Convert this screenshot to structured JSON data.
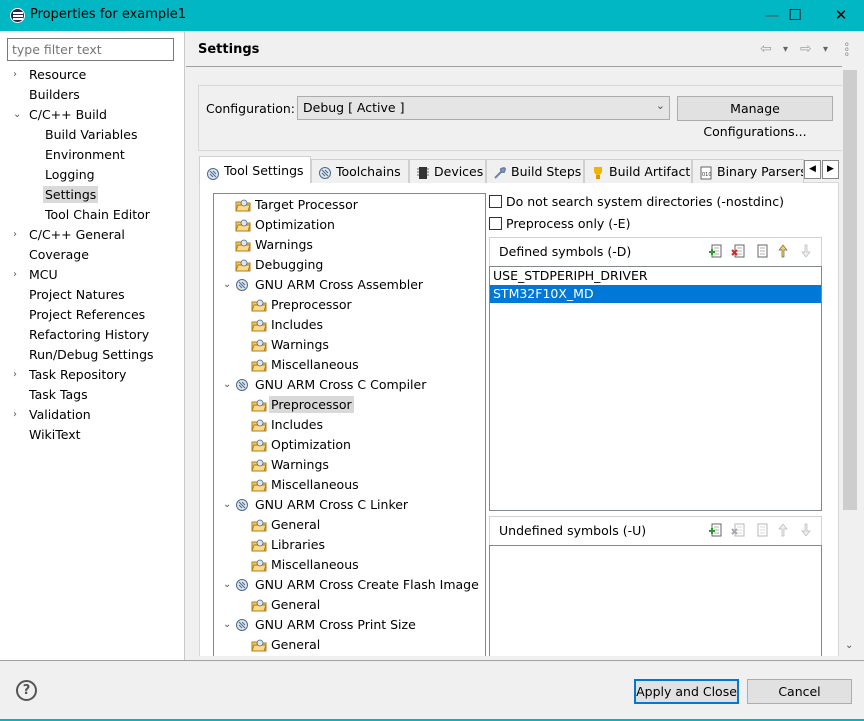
{
  "window": {
    "title": "Properties for example1",
    "minimize": "—",
    "maximize": "☐",
    "close": "✕",
    "accent": "#00b7c3"
  },
  "filter": {
    "placeholder": "type filter text"
  },
  "nav": [
    {
      "label": "Resource",
      "level": 0,
      "arrow": "›"
    },
    {
      "label": "Builders",
      "level": 0
    },
    {
      "label": "C/C++ Build",
      "level": 0,
      "arrow": "⌄"
    },
    {
      "label": "Build Variables",
      "level": 1
    },
    {
      "label": "Environment",
      "level": 1
    },
    {
      "label": "Logging",
      "level": 1
    },
    {
      "label": "Settings",
      "level": 1,
      "selected": true
    },
    {
      "label": "Tool Chain Editor",
      "level": 1
    },
    {
      "label": "C/C++ General",
      "level": 0,
      "arrow": "›"
    },
    {
      "label": "Coverage",
      "level": 0
    },
    {
      "label": "MCU",
      "level": 0,
      "arrow": "›"
    },
    {
      "label": "Project Natures",
      "level": 0
    },
    {
      "label": "Project References",
      "level": 0
    },
    {
      "label": "Refactoring History",
      "level": 0
    },
    {
      "label": "Run/Debug Settings",
      "level": 0
    },
    {
      "label": "Task Repository",
      "level": 0,
      "arrow": "›"
    },
    {
      "label": "Task Tags",
      "level": 0
    },
    {
      "label": "Validation",
      "level": 0,
      "arrow": "›"
    },
    {
      "label": "WikiText",
      "level": 0
    }
  ],
  "header": {
    "title": "Settings",
    "back_icon": "⇦",
    "forward_icon": "⇨",
    "menu_icon": "▾"
  },
  "configuration": {
    "label": "Configuration:",
    "value": "Debug  [ Active ]",
    "manage_label": "Manage Configurations..."
  },
  "tabs": [
    {
      "label": "Tool Settings",
      "icon": "gear-icon",
      "active": true
    },
    {
      "label": "Toolchains",
      "icon": "gear-icon"
    },
    {
      "label": "Devices",
      "icon": "chip-icon"
    },
    {
      "label": "Build Steps",
      "icon": "wrench-icon"
    },
    {
      "label": "Build Artifact",
      "icon": "trophy-icon"
    },
    {
      "label": "Binary Parsers",
      "icon": "binary-file-icon"
    }
  ],
  "tool_tree": [
    {
      "label": "Target Processor",
      "level": 0
    },
    {
      "label": "Optimization",
      "level": 0
    },
    {
      "label": "Warnings",
      "level": 0
    },
    {
      "label": "Debugging",
      "level": 0
    },
    {
      "label": "GNU ARM Cross Assembler",
      "level": 0,
      "tool": true
    },
    {
      "label": "Preprocessor",
      "level": 1
    },
    {
      "label": "Includes",
      "level": 1
    },
    {
      "label": "Warnings",
      "level": 1
    },
    {
      "label": "Miscellaneous",
      "level": 1
    },
    {
      "label": "GNU ARM Cross C Compiler",
      "level": 0,
      "tool": true
    },
    {
      "label": "Preprocessor",
      "level": 1,
      "selected": true
    },
    {
      "label": "Includes",
      "level": 1
    },
    {
      "label": "Optimization",
      "level": 1
    },
    {
      "label": "Warnings",
      "level": 1
    },
    {
      "label": "Miscellaneous",
      "level": 1
    },
    {
      "label": "GNU ARM Cross C Linker",
      "level": 0,
      "tool": true
    },
    {
      "label": "General",
      "level": 1
    },
    {
      "label": "Libraries",
      "level": 1
    },
    {
      "label": "Miscellaneous",
      "level": 1
    },
    {
      "label": "GNU ARM Cross Create Flash Image",
      "level": 0,
      "tool": true
    },
    {
      "label": "General",
      "level": 1
    },
    {
      "label": "GNU ARM Cross Print Size",
      "level": 0,
      "tool": true
    },
    {
      "label": "General",
      "level": 1
    }
  ],
  "options": {
    "nostdinc": {
      "label": "Do not search system directories (-nostdinc)",
      "checked": false
    },
    "preprocess_only": {
      "label": "Preprocess only (-E)",
      "checked": false
    }
  },
  "defined_symbols": {
    "title": "Defined symbols (-D)",
    "items": [
      "USE_STDPERIPH_DRIVER",
      "STM32F10X_MD"
    ],
    "selected_index": 1
  },
  "undefined_symbols": {
    "title": "Undefined symbols (-U)",
    "items": []
  },
  "footer": {
    "help": "?",
    "apply_label": "Apply and Close",
    "cancel_label": "Cancel"
  }
}
